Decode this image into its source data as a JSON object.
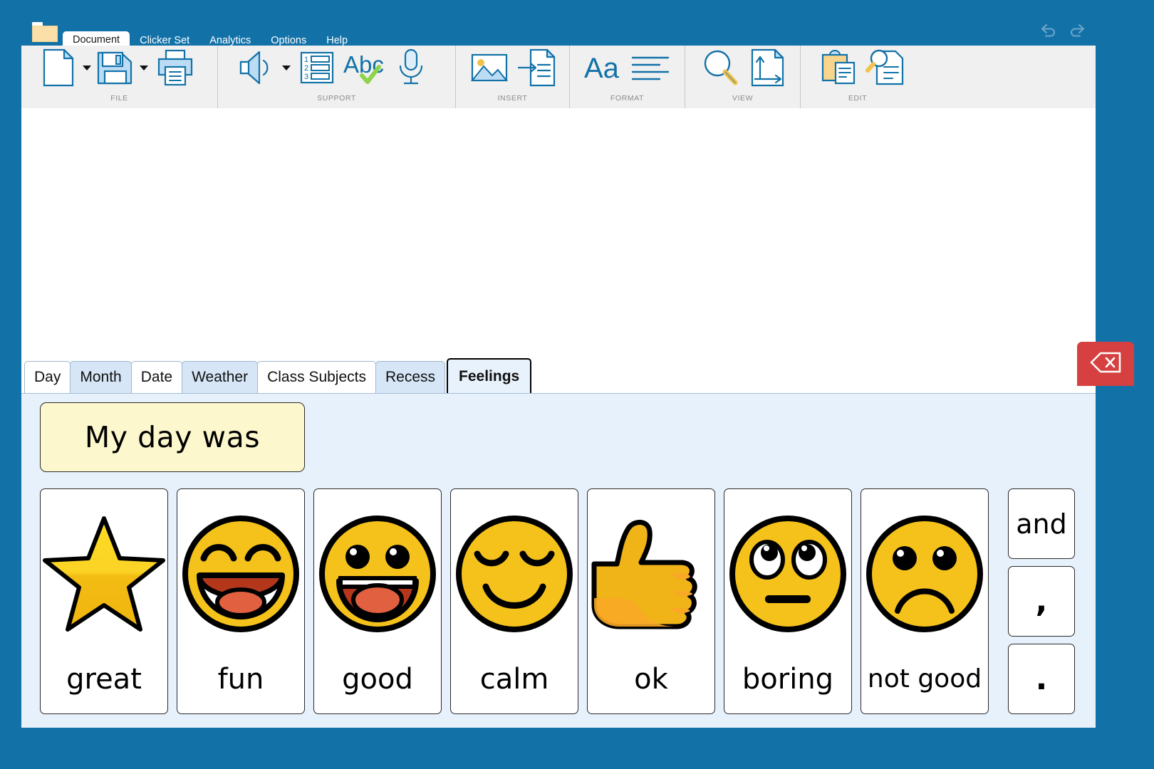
{
  "window": {
    "chrome_color": "#1272a8",
    "ribbon_bg": "#f0f0f0",
    "accent_blue": "#1272a8"
  },
  "titlebar": {
    "folder_icon": "folder-icon",
    "menu_items": [
      {
        "label": "Document",
        "active": true
      },
      {
        "label": "Clicker Set",
        "active": false
      },
      {
        "label": "Analytics",
        "active": false
      },
      {
        "label": "Options",
        "active": false
      },
      {
        "label": "Help",
        "active": false
      }
    ],
    "undo_icon": "undo-arrow-icon",
    "redo_icon": "redo-arrow-icon"
  },
  "ribbon": {
    "groups": [
      {
        "label": "FILE",
        "buttons": [
          {
            "icon": "new-document-icon",
            "caret": true
          },
          {
            "icon": "save-floppy-icon",
            "caret": true
          },
          {
            "icon": "print-icon",
            "caret": false
          }
        ]
      },
      {
        "label": "SUPPORT",
        "buttons": [
          {
            "icon": "speaker-sound-icon",
            "caret": true
          },
          {
            "icon": "numbered-list-icon",
            "caret": false
          },
          {
            "icon": "spellcheck-abc-icon",
            "caret": false
          },
          {
            "icon": "microphone-icon",
            "caret": false
          }
        ]
      },
      {
        "label": "INSERT",
        "buttons": [
          {
            "icon": "insert-picture-icon",
            "caret": false
          },
          {
            "icon": "insert-page-icon",
            "caret": false
          }
        ]
      },
      {
        "label": "FORMAT",
        "buttons": [
          {
            "icon": "font-aa-icon",
            "caret": false
          },
          {
            "icon": "paragraph-align-icon",
            "caret": false
          }
        ]
      },
      {
        "label": "VIEW",
        "buttons": [
          {
            "icon": "zoom-magnifier-icon",
            "caret": false
          },
          {
            "icon": "page-orientation-icon",
            "caret": false
          }
        ]
      },
      {
        "label": "EDIT",
        "buttons": [
          {
            "icon": "clipboard-paste-icon",
            "caret": false
          },
          {
            "icon": "find-replace-icon",
            "caret": false
          }
        ]
      }
    ]
  },
  "document": {
    "content": ""
  },
  "gridtabs": [
    {
      "label": "Day",
      "style": "plain",
      "active": false
    },
    {
      "label": "Month",
      "style": "alt",
      "active": false
    },
    {
      "label": "Date",
      "style": "plain",
      "active": false
    },
    {
      "label": "Weather",
      "style": "alt",
      "active": false
    },
    {
      "label": "Class Subjects",
      "style": "plain",
      "active": false
    },
    {
      "label": "Recess",
      "style": "alt",
      "active": false
    },
    {
      "label": "Feelings",
      "style": "plain",
      "active": true
    }
  ],
  "delete_button": {
    "icon": "backspace-delete-icon",
    "color": "#d64040"
  },
  "grid": {
    "sentence_starter": "My day was",
    "cards": [
      {
        "label": "great",
        "art": "gold-star-icon"
      },
      {
        "label": "fun",
        "art": "laughing-face-icon"
      },
      {
        "label": "good",
        "art": "grinning-face-icon"
      },
      {
        "label": "calm",
        "art": "relieved-face-icon"
      },
      {
        "label": "ok",
        "art": "thumbs-up-icon"
      },
      {
        "label": "boring",
        "art": "eye-roll-face-icon"
      },
      {
        "label": "not good",
        "art": "sad-face-icon"
      }
    ],
    "word_cards": [
      {
        "label": "and",
        "kind": "word"
      },
      {
        "label": ",",
        "kind": "punct"
      },
      {
        "label": ".",
        "kind": "punct"
      }
    ],
    "panel_bg": "#e7f1fc",
    "sentence_bg": "#fdf7cd",
    "emoji_yellow": "#f5c21b",
    "mouth_red": "#bf3a1d"
  }
}
